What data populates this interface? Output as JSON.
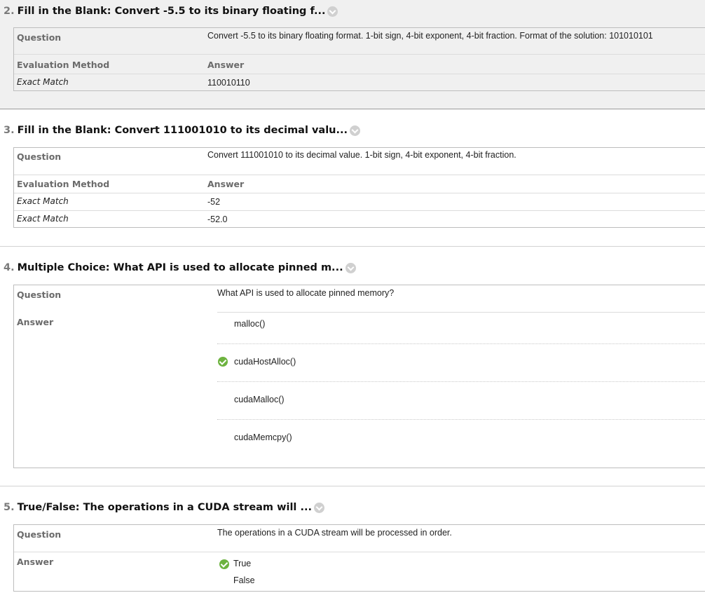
{
  "q2": {
    "number": "2.",
    "title": "Fill in the Blank: Convert -5.5 to its binary floating f...",
    "question_label": "Question",
    "question_text": "Convert -5.5 to its binary floating format. 1-bit sign, 4-bit exponent, 4-bit fraction. Format of the solution: 101010101",
    "eval_label": "Evaluation Method",
    "answer_label": "Answer",
    "rows": [
      {
        "method": "Exact Match",
        "answer": "110010110"
      }
    ]
  },
  "q3": {
    "number": "3.",
    "title": "Fill in the Blank: Convert 111001010 to its decimal valu...",
    "question_label": "Question",
    "question_text": "Convert 111001010 to its decimal value. 1-bit sign, 4-bit exponent, 4-bit fraction.",
    "eval_label": "Evaluation Method",
    "answer_label": "Answer",
    "rows": [
      {
        "method": "Exact Match",
        "answer": "-52"
      },
      {
        "method": "Exact Match",
        "answer": "-52.0"
      }
    ]
  },
  "q4": {
    "number": "4.",
    "title": "Multiple Choice: What API is used to allocate pinned m...",
    "question_label": "Question",
    "question_text": "What API is used to allocate pinned memory?",
    "answer_label": "Answer",
    "options": [
      "malloc()",
      "cudaHostAlloc()",
      "cudaMalloc()",
      "cudaMemcpy()"
    ],
    "correct_index": 1
  },
  "q5": {
    "number": "5.",
    "title": "True/False: The operations in a CUDA stream will ...",
    "question_label": "Question",
    "question_text": "The operations in a CUDA stream will be processed in order.",
    "answer_label": "Answer",
    "options": [
      "True",
      "False"
    ],
    "correct_index": 0
  },
  "colors": {
    "correct_check": "#6db33f",
    "label_gray": "#6b6b6b",
    "header_bg": "#f0f0f0"
  },
  "icons": {
    "title_toggle": "chevron-down-icon",
    "correct_marker": "check-circle-icon"
  }
}
